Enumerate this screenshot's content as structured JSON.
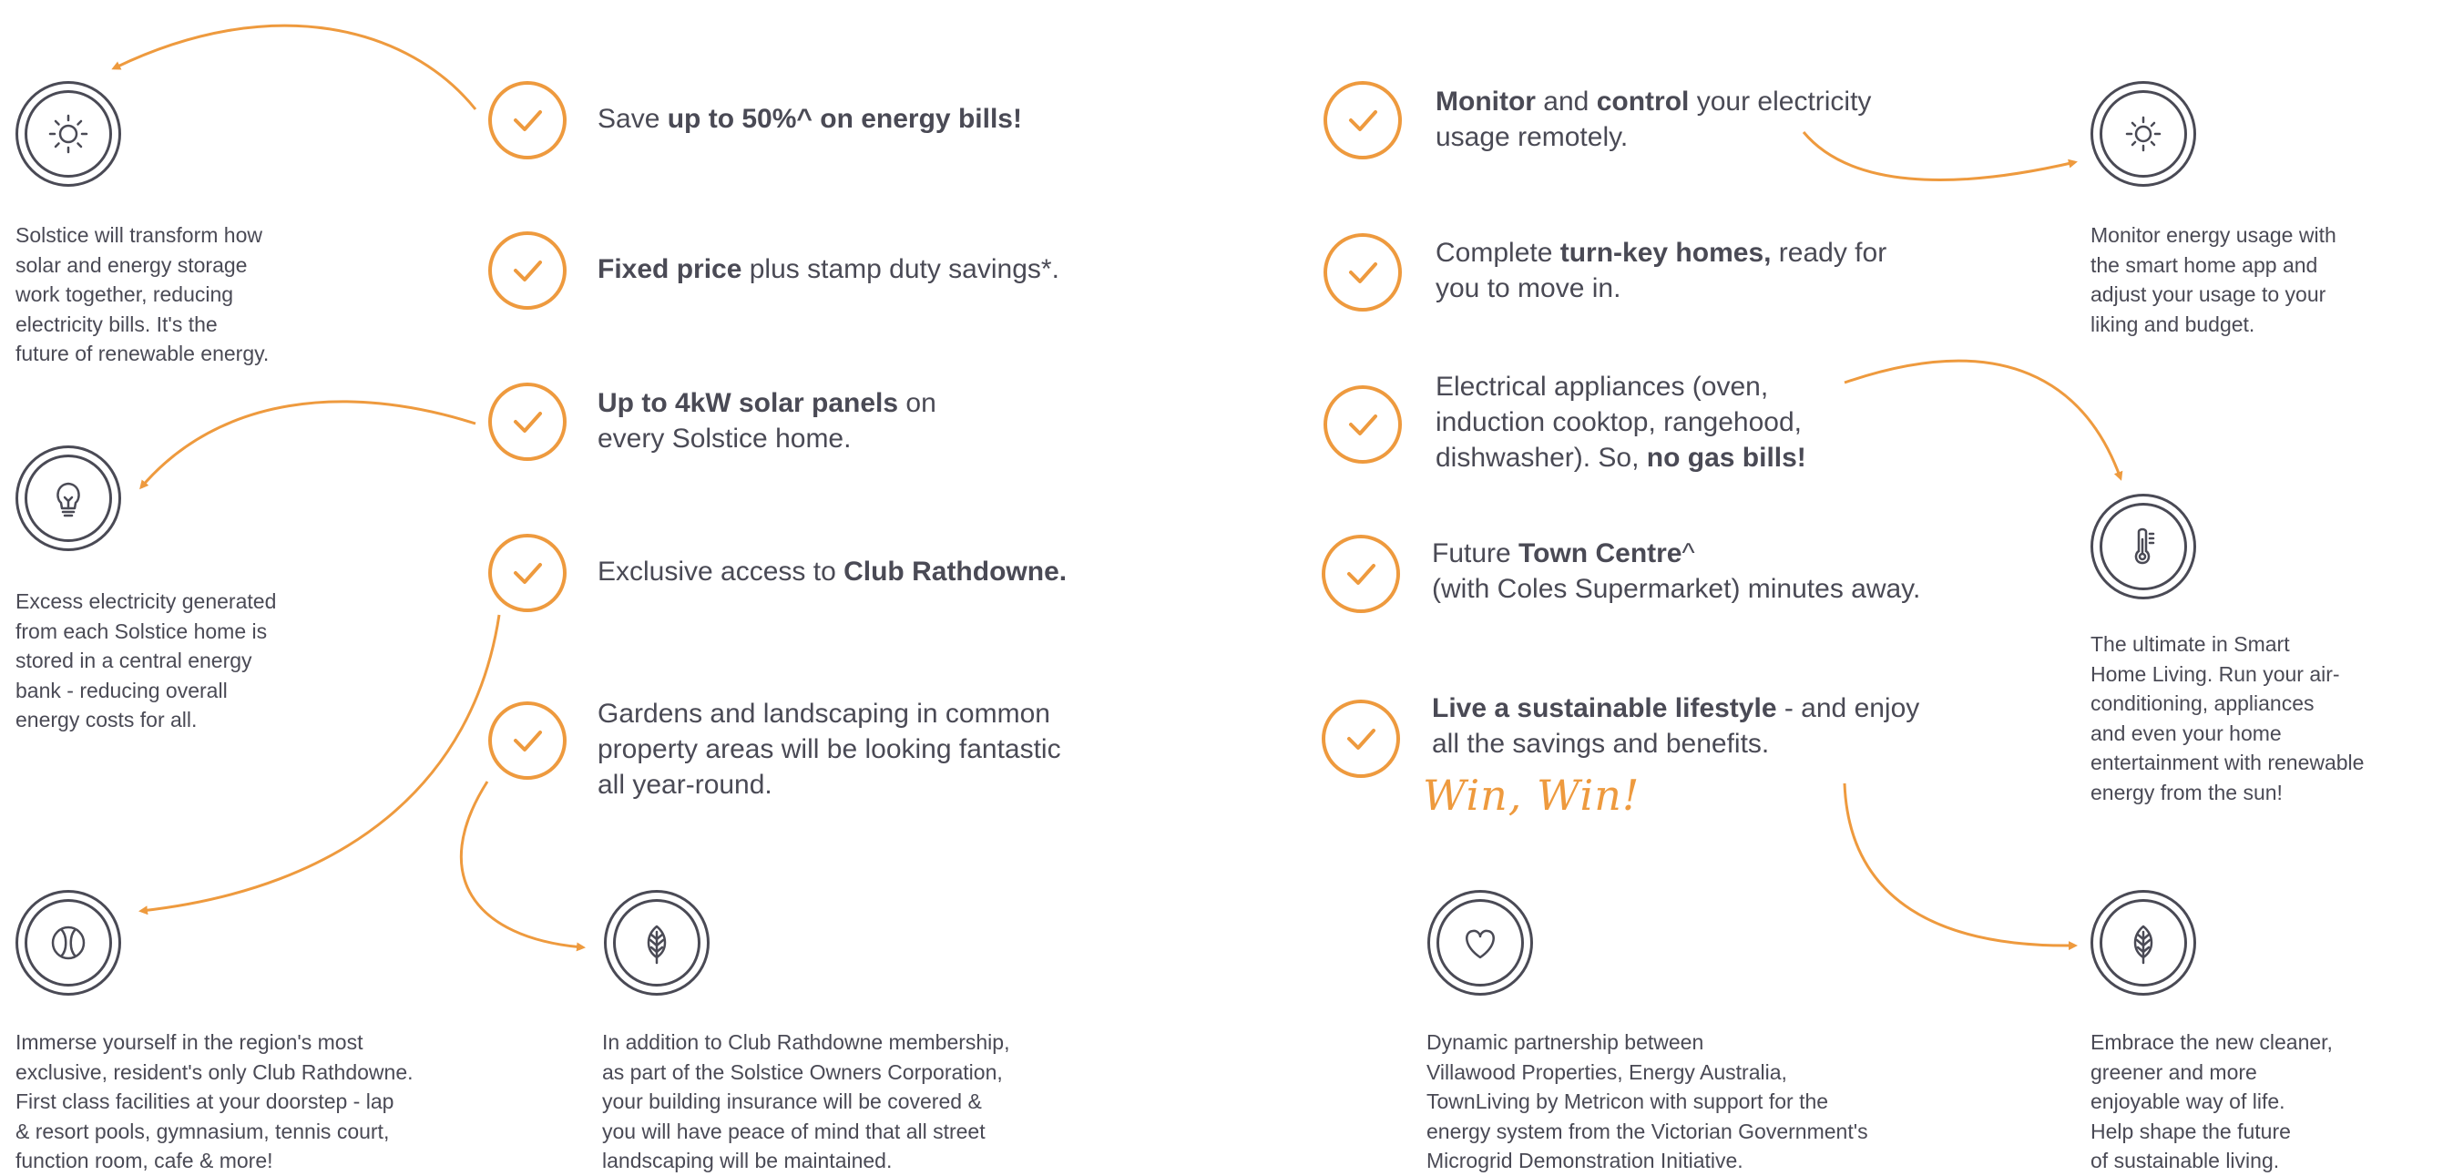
{
  "colors": {
    "accent": "#ee9a3e",
    "text": "#4a4a55",
    "background": "#ffffff"
  },
  "left_features": [
    {
      "pre": "Save ",
      "b1": "up to 50%^ on energy bills!",
      "mid": "",
      "b2": "",
      "post": ""
    },
    {
      "pre": "",
      "b1": "Fixed price",
      "mid": " plus stamp duty savings*.",
      "b2": "",
      "post": ""
    },
    {
      "pre": "",
      "b1": "Up to 4kW solar panels",
      "mid": " on\nevery Solstice home.",
      "b2": "",
      "post": ""
    },
    {
      "pre": "Exclusive access to ",
      "b1": "Club Rathdowne.",
      "mid": "",
      "b2": "",
      "post": ""
    },
    {
      "pre": "Gardens and landscaping in common\nproperty areas will be looking fantastic\nall year-round.",
      "b1": "",
      "mid": "",
      "b2": "",
      "post": ""
    }
  ],
  "right_features": [
    {
      "pre": "",
      "b1": "Monitor",
      "mid": " and ",
      "b2": "control",
      "post": " your electricity\nusage remotely."
    },
    {
      "pre": "Complete ",
      "b1": "turn-key homes,",
      "mid": " ready for\nyou to move in.",
      "b2": "",
      "post": ""
    },
    {
      "pre": "Electrical appliances (oven,\ninduction cooktop, rangehood,\ndishwasher). So, ",
      "b1": "no gas bills!",
      "mid": "",
      "b2": "",
      "post": ""
    },
    {
      "pre": "Future ",
      "b1": "Town Centre",
      "mid": "^\n(with Coles Supermarket) minutes away.",
      "b2": "",
      "post": ""
    },
    {
      "pre": "",
      "b1": "Live a sustainable lifestyle",
      "mid": " - and enjoy\nall the savings and benefits.",
      "b2": "",
      "post": ""
    }
  ],
  "tagline": "Win, Win!",
  "icons": [
    {
      "name": "sun-icon"
    },
    {
      "name": "lightbulb-icon"
    },
    {
      "name": "tennis-ball-icon"
    },
    {
      "name": "leaf-icon"
    },
    {
      "name": "heart-icon"
    },
    {
      "name": "sun-icon"
    },
    {
      "name": "thermometer-icon"
    },
    {
      "name": "leaf-icon"
    }
  ],
  "descriptions": {
    "solar": "Solstice will transform how\nsolar and energy storage\nwork together, reducing\nelectricity bills. It's the\nfuture of renewable energy.",
    "storage": "Excess electricity generated\nfrom each Solstice home is\nstored in a central energy\nbank - reducing overall\nenergy costs for all.",
    "club": "Immerse yourself in the region's most\nexclusive, resident's only Club Rathdowne.\nFirst class facilities at your doorstep - lap\n& resort pools, gymnasium, tennis court,\nfunction room, cafe & more!",
    "insurance": "In addition to Club Rathdowne membership,\nas part of the Solstice Owners Corporation,\nyour building insurance will be covered &\nyou will have peace of mind that all street\nlandscaping will be maintained.",
    "partnership": "Dynamic partnership between\nVillawood Properties, Energy Australia,\nTownLiving by Metricon with support for the\nenergy system from the Victorian Government's\nMicrogrid Demonstration Initiative.",
    "monitor": "Monitor energy usage with\nthe smart home app and\nadjust your usage to your\nliking and budget.",
    "smart_home": "The ultimate in Smart\nHome Living. Run your air-\nconditioning, appliances\nand even your home\nentertainment with renewable\nenergy from the sun!",
    "embrace": "Embrace the new cleaner,\ngreener and more\nenjoyable way of life.\nHelp shape the future\nof sustainable living."
  }
}
